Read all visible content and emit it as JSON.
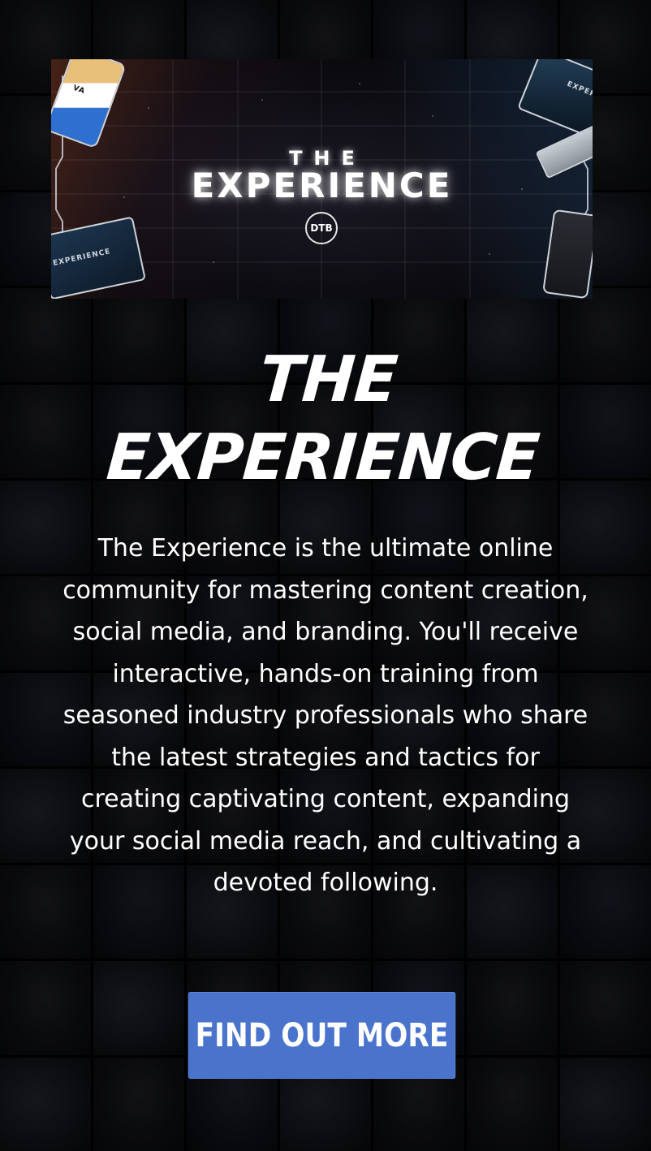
{
  "banner": {
    "title_small": "THE",
    "title_big": "EXPERIENCE",
    "logo_text": "DTB",
    "device_texts": {
      "phone_tl_label": "VA",
      "tablet_tr_label": "EXPERIENCE",
      "laptop_bl_label": "EXPERIENCE"
    }
  },
  "headline": {
    "line1": "THE",
    "line2": "EXPERIENCE"
  },
  "description": "The Experience is the ultimate online community for mastering content creation, social media, and branding. You'll receive interactive, hands-on training from seasoned industry professionals who share the latest strategies and tactics for creating captivating content, expanding your social media reach, and cultivating a devoted following.",
  "cta": {
    "label": "FIND OUT MORE"
  },
  "colors": {
    "background": "#000000",
    "button": "#4a73cc",
    "text": "#ffffff"
  }
}
